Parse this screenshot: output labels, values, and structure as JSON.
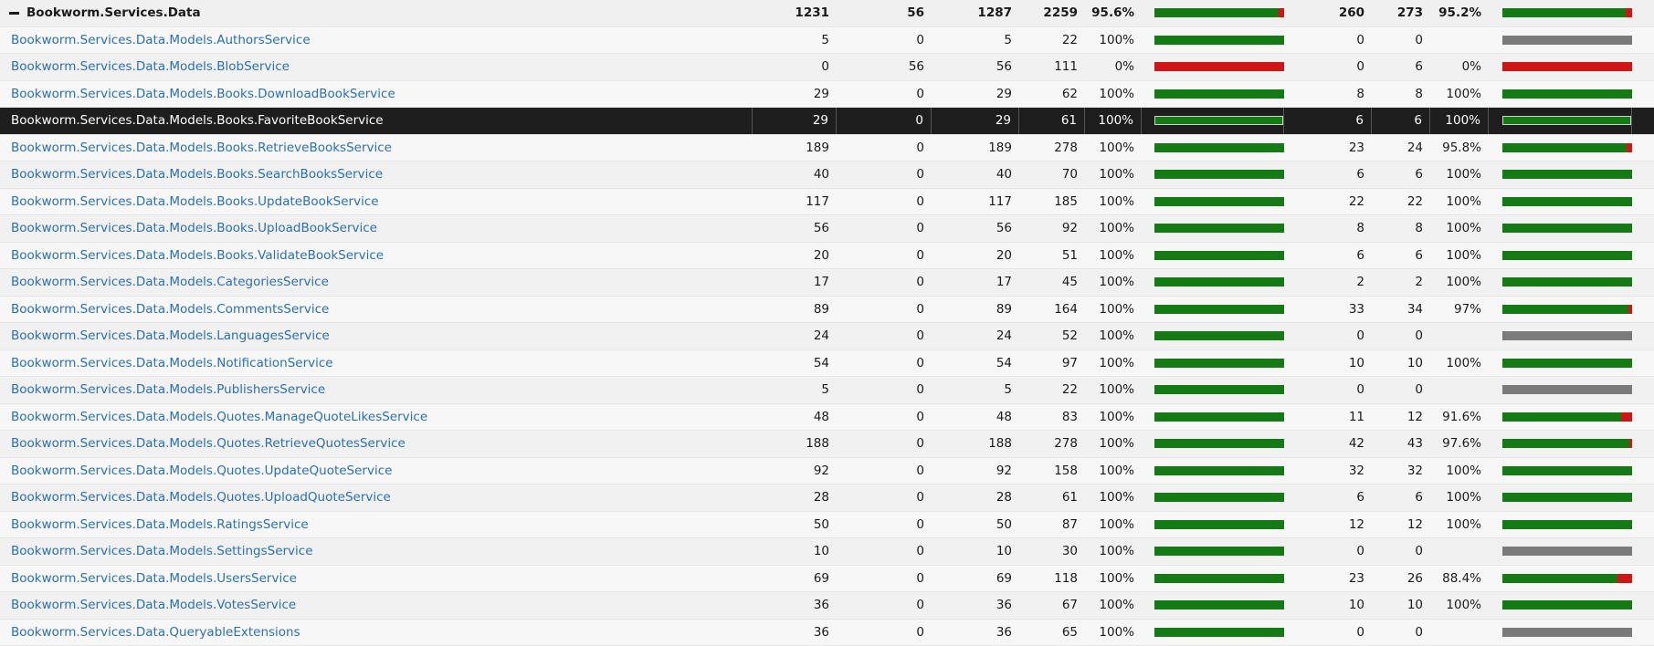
{
  "colors": {
    "covered": "#147a14",
    "uncovered": "#d21414",
    "not_applicable": "#7a7a7a",
    "link": "#2a6fb8",
    "selected_row": "#1e1e1e"
  },
  "rows": [
    {
      "name": "Bookworm.Services.Data",
      "covered": "1231",
      "uncovered": "56",
      "coverable": "1287",
      "total": "2259",
      "line_pct": "95.6%",
      "line_frac": 0.956,
      "branch_covered": "260",
      "branch_total": "273",
      "branch_pct": "95.2%",
      "branch_frac": 0.952,
      "header": true
    },
    {
      "name": "Bookworm.Services.Data.Models.AuthorsService",
      "covered": "5",
      "uncovered": "0",
      "coverable": "5",
      "total": "22",
      "line_pct": "100%",
      "line_frac": 1,
      "branch_covered": "0",
      "branch_total": "0",
      "branch_pct": "",
      "branch_frac": null
    },
    {
      "name": "Bookworm.Services.Data.Models.BlobService",
      "covered": "0",
      "uncovered": "56",
      "coverable": "56",
      "total": "111",
      "line_pct": "0%",
      "line_frac": 0,
      "branch_covered": "0",
      "branch_total": "6",
      "branch_pct": "0%",
      "branch_frac": 0
    },
    {
      "name": "Bookworm.Services.Data.Models.Books.DownloadBookService",
      "covered": "29",
      "uncovered": "0",
      "coverable": "29",
      "total": "62",
      "line_pct": "100%",
      "line_frac": 1,
      "branch_covered": "8",
      "branch_total": "8",
      "branch_pct": "100%",
      "branch_frac": 1
    },
    {
      "name": "Bookworm.Services.Data.Models.Books.FavoriteBookService",
      "covered": "29",
      "uncovered": "0",
      "coverable": "29",
      "total": "61",
      "line_pct": "100%",
      "line_frac": 1,
      "branch_covered": "6",
      "branch_total": "6",
      "branch_pct": "100%",
      "branch_frac": 1,
      "selected": true
    },
    {
      "name": "Bookworm.Services.Data.Models.Books.RetrieveBooksService",
      "covered": "189",
      "uncovered": "0",
      "coverable": "189",
      "total": "278",
      "line_pct": "100%",
      "line_frac": 1,
      "branch_covered": "23",
      "branch_total": "24",
      "branch_pct": "95.8%",
      "branch_frac": 0.958
    },
    {
      "name": "Bookworm.Services.Data.Models.Books.SearchBooksService",
      "covered": "40",
      "uncovered": "0",
      "coverable": "40",
      "total": "70",
      "line_pct": "100%",
      "line_frac": 1,
      "branch_covered": "6",
      "branch_total": "6",
      "branch_pct": "100%",
      "branch_frac": 1
    },
    {
      "name": "Bookworm.Services.Data.Models.Books.UpdateBookService",
      "covered": "117",
      "uncovered": "0",
      "coverable": "117",
      "total": "185",
      "line_pct": "100%",
      "line_frac": 1,
      "branch_covered": "22",
      "branch_total": "22",
      "branch_pct": "100%",
      "branch_frac": 1
    },
    {
      "name": "Bookworm.Services.Data.Models.Books.UploadBookService",
      "covered": "56",
      "uncovered": "0",
      "coverable": "56",
      "total": "92",
      "line_pct": "100%",
      "line_frac": 1,
      "branch_covered": "8",
      "branch_total": "8",
      "branch_pct": "100%",
      "branch_frac": 1
    },
    {
      "name": "Bookworm.Services.Data.Models.Books.ValidateBookService",
      "covered": "20",
      "uncovered": "0",
      "coverable": "20",
      "total": "51",
      "line_pct": "100%",
      "line_frac": 1,
      "branch_covered": "6",
      "branch_total": "6",
      "branch_pct": "100%",
      "branch_frac": 1
    },
    {
      "name": "Bookworm.Services.Data.Models.CategoriesService",
      "covered": "17",
      "uncovered": "0",
      "coverable": "17",
      "total": "45",
      "line_pct": "100%",
      "line_frac": 1,
      "branch_covered": "2",
      "branch_total": "2",
      "branch_pct": "100%",
      "branch_frac": 1
    },
    {
      "name": "Bookworm.Services.Data.Models.CommentsService",
      "covered": "89",
      "uncovered": "0",
      "coverable": "89",
      "total": "164",
      "line_pct": "100%",
      "line_frac": 1,
      "branch_covered": "33",
      "branch_total": "34",
      "branch_pct": "97%",
      "branch_frac": 0.97
    },
    {
      "name": "Bookworm.Services.Data.Models.LanguagesService",
      "covered": "24",
      "uncovered": "0",
      "coverable": "24",
      "total": "52",
      "line_pct": "100%",
      "line_frac": 1,
      "branch_covered": "0",
      "branch_total": "0",
      "branch_pct": "",
      "branch_frac": null
    },
    {
      "name": "Bookworm.Services.Data.Models.NotificationService",
      "covered": "54",
      "uncovered": "0",
      "coverable": "54",
      "total": "97",
      "line_pct": "100%",
      "line_frac": 1,
      "branch_covered": "10",
      "branch_total": "10",
      "branch_pct": "100%",
      "branch_frac": 1
    },
    {
      "name": "Bookworm.Services.Data.Models.PublishersService",
      "covered": "5",
      "uncovered": "0",
      "coverable": "5",
      "total": "22",
      "line_pct": "100%",
      "line_frac": 1,
      "branch_covered": "0",
      "branch_total": "0",
      "branch_pct": "",
      "branch_frac": null
    },
    {
      "name": "Bookworm.Services.Data.Models.Quotes.ManageQuoteLikesService",
      "covered": "48",
      "uncovered": "0",
      "coverable": "48",
      "total": "83",
      "line_pct": "100%",
      "line_frac": 1,
      "branch_covered": "11",
      "branch_total": "12",
      "branch_pct": "91.6%",
      "branch_frac": 0.916
    },
    {
      "name": "Bookworm.Services.Data.Models.Quotes.RetrieveQuotesService",
      "covered": "188",
      "uncovered": "0",
      "coverable": "188",
      "total": "278",
      "line_pct": "100%",
      "line_frac": 1,
      "branch_covered": "42",
      "branch_total": "43",
      "branch_pct": "97.6%",
      "branch_frac": 0.976
    },
    {
      "name": "Bookworm.Services.Data.Models.Quotes.UpdateQuoteService",
      "covered": "92",
      "uncovered": "0",
      "coverable": "92",
      "total": "158",
      "line_pct": "100%",
      "line_frac": 1,
      "branch_covered": "32",
      "branch_total": "32",
      "branch_pct": "100%",
      "branch_frac": 1
    },
    {
      "name": "Bookworm.Services.Data.Models.Quotes.UploadQuoteService",
      "covered": "28",
      "uncovered": "0",
      "coverable": "28",
      "total": "61",
      "line_pct": "100%",
      "line_frac": 1,
      "branch_covered": "6",
      "branch_total": "6",
      "branch_pct": "100%",
      "branch_frac": 1
    },
    {
      "name": "Bookworm.Services.Data.Models.RatingsService",
      "covered": "50",
      "uncovered": "0",
      "coverable": "50",
      "total": "87",
      "line_pct": "100%",
      "line_frac": 1,
      "branch_covered": "12",
      "branch_total": "12",
      "branch_pct": "100%",
      "branch_frac": 1
    },
    {
      "name": "Bookworm.Services.Data.Models.SettingsService",
      "covered": "10",
      "uncovered": "0",
      "coverable": "10",
      "total": "30",
      "line_pct": "100%",
      "line_frac": 1,
      "branch_covered": "0",
      "branch_total": "0",
      "branch_pct": "",
      "branch_frac": null
    },
    {
      "name": "Bookworm.Services.Data.Models.UsersService",
      "covered": "69",
      "uncovered": "0",
      "coverable": "69",
      "total": "118",
      "line_pct": "100%",
      "line_frac": 1,
      "branch_covered": "23",
      "branch_total": "26",
      "branch_pct": "88.4%",
      "branch_frac": 0.884
    },
    {
      "name": "Bookworm.Services.Data.Models.VotesService",
      "covered": "36",
      "uncovered": "0",
      "coverable": "36",
      "total": "67",
      "line_pct": "100%",
      "line_frac": 1,
      "branch_covered": "10",
      "branch_total": "10",
      "branch_pct": "100%",
      "branch_frac": 1
    },
    {
      "name": "Bookworm.Services.Data.QueryableExtensions",
      "covered": "36",
      "uncovered": "0",
      "coverable": "36",
      "total": "65",
      "line_pct": "100%",
      "line_frac": 1,
      "branch_covered": "0",
      "branch_total": "0",
      "branch_pct": "",
      "branch_frac": null
    }
  ]
}
